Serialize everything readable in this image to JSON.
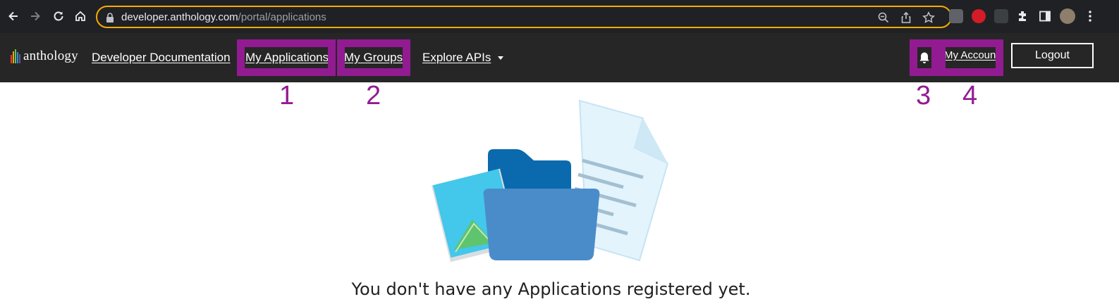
{
  "browser": {
    "url_domain": "developer.anthology.com",
    "url_path": "/portal/applications",
    "icons": [
      "back-icon",
      "forward-icon",
      "reload-icon",
      "home-icon",
      "lock-icon",
      "zoom-icon",
      "share-icon",
      "star-icon",
      "extensions-icon",
      "side-panel-icon",
      "profile-avatar",
      "menu-icon"
    ]
  },
  "header": {
    "logo_text": "anthology",
    "nav": {
      "developer_documentation": "Developer Documentation",
      "my_applications": "My Applications",
      "my_groups": "My Groups",
      "explore_apis": "Explore APIs"
    },
    "my_account": "My Account",
    "logout": "Logout"
  },
  "annotations": {
    "n1": "1",
    "n2": "2",
    "n3": "3",
    "n4": "4"
  },
  "empty_state": {
    "message": "You don't have any Applications registered yet."
  },
  "colors": {
    "header_bg": "#262626",
    "highlight": "#921b92",
    "omnibox_border": "#f9ab00",
    "folder_dark": "#0a6aad",
    "folder_front": "#4a8cc9",
    "photo_bg": "#43c7ea",
    "document_bg": "#e4f4fc"
  }
}
